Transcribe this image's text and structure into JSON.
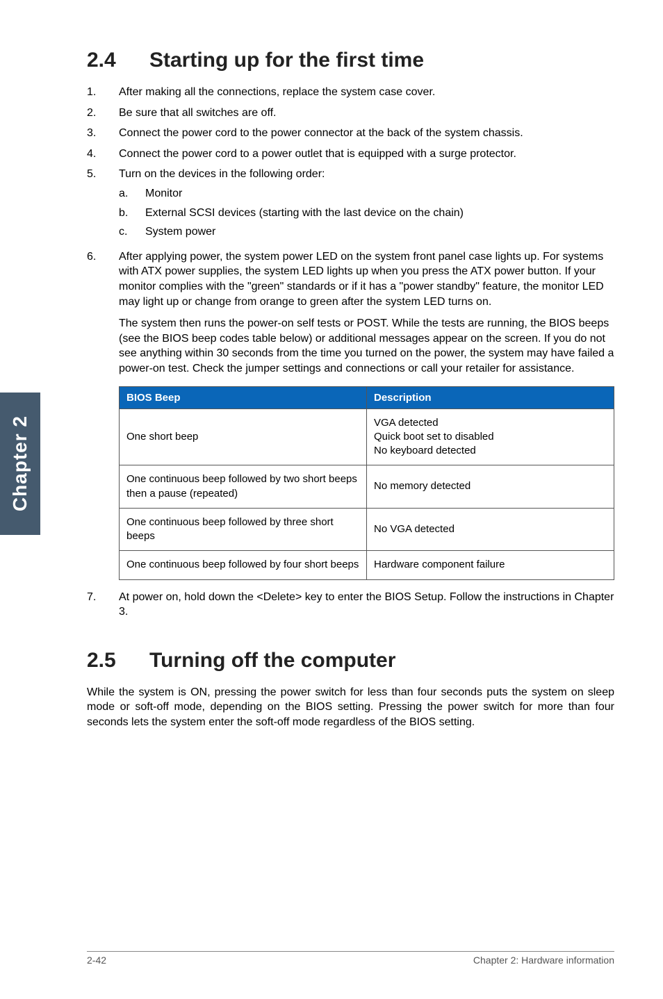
{
  "sidebar": {
    "label": "Chapter 2"
  },
  "sec24": {
    "num": "2.4",
    "title": "Starting up for the first time",
    "steps": [
      {
        "n": "1.",
        "t": "After making all the connections, replace the system case cover."
      },
      {
        "n": "2.",
        "t": "Be sure that all switches are off."
      },
      {
        "n": "3.",
        "t": "Connect the power cord to the power connector at the back of the system chassis."
      },
      {
        "n": "4.",
        "t": "Connect the power cord to a power outlet that is equipped with a surge protector."
      },
      {
        "n": "5.",
        "t": "Turn on the devices in the following order:",
        "sub": [
          {
            "n": "a.",
            "t": "Monitor"
          },
          {
            "n": "b.",
            "t": "External SCSI devices (starting with the last device on the chain)"
          },
          {
            "n": "c.",
            "t": "System power"
          }
        ]
      },
      {
        "n": "6.",
        "t": "After applying power, the system power LED on the system front panel case lights up. For systems with ATX power supplies, the system LED lights up when you press the ATX power button. If your monitor complies with the \"green\" standards or if it has a \"power standby\" feature, the monitor LED may light up or change from orange to green after the system LED turns on.",
        "para2": "The system then runs the power-on self tests or POST. While the tests are running, the BIOS beeps (see the BIOS beep codes table below) or additional messages appear on the screen. If you do not see anything within 30 seconds from the time you turned on the power, the system may have failed a power-on test. Check the jumper settings and connections or call your retailer for assistance."
      }
    ],
    "table": {
      "head": {
        "c1": "BIOS Beep",
        "c2": "Description"
      },
      "rows": [
        {
          "c1": "One short beep",
          "c2": "VGA detected\nQuick boot set to disabled\nNo keyboard detected"
        },
        {
          "c1": "One continuous beep followed by two short beeps then a pause (repeated)",
          "c2": "No memory detected"
        },
        {
          "c1": "One continuous beep followed by three short beeps",
          "c2": "No VGA detected"
        },
        {
          "c1": "One continuous beep followed by four short beeps",
          "c2": "Hardware component failure"
        }
      ]
    },
    "step7": {
      "n": "7.",
      "t": "At power on, hold down the <Delete> key to enter the BIOS Setup. Follow the instructions in Chapter 3."
    }
  },
  "sec25": {
    "num": "2.5",
    "title": "Turning off the computer",
    "body": "While the system is ON, pressing the power switch for less than four seconds puts the system on sleep mode or soft-off mode, depending on the BIOS setting. Pressing the power switch for more than four seconds lets the system enter the soft-off mode regardless of the BIOS setting."
  },
  "footer": {
    "left": "2-42",
    "right": "Chapter 2: Hardware information"
  }
}
